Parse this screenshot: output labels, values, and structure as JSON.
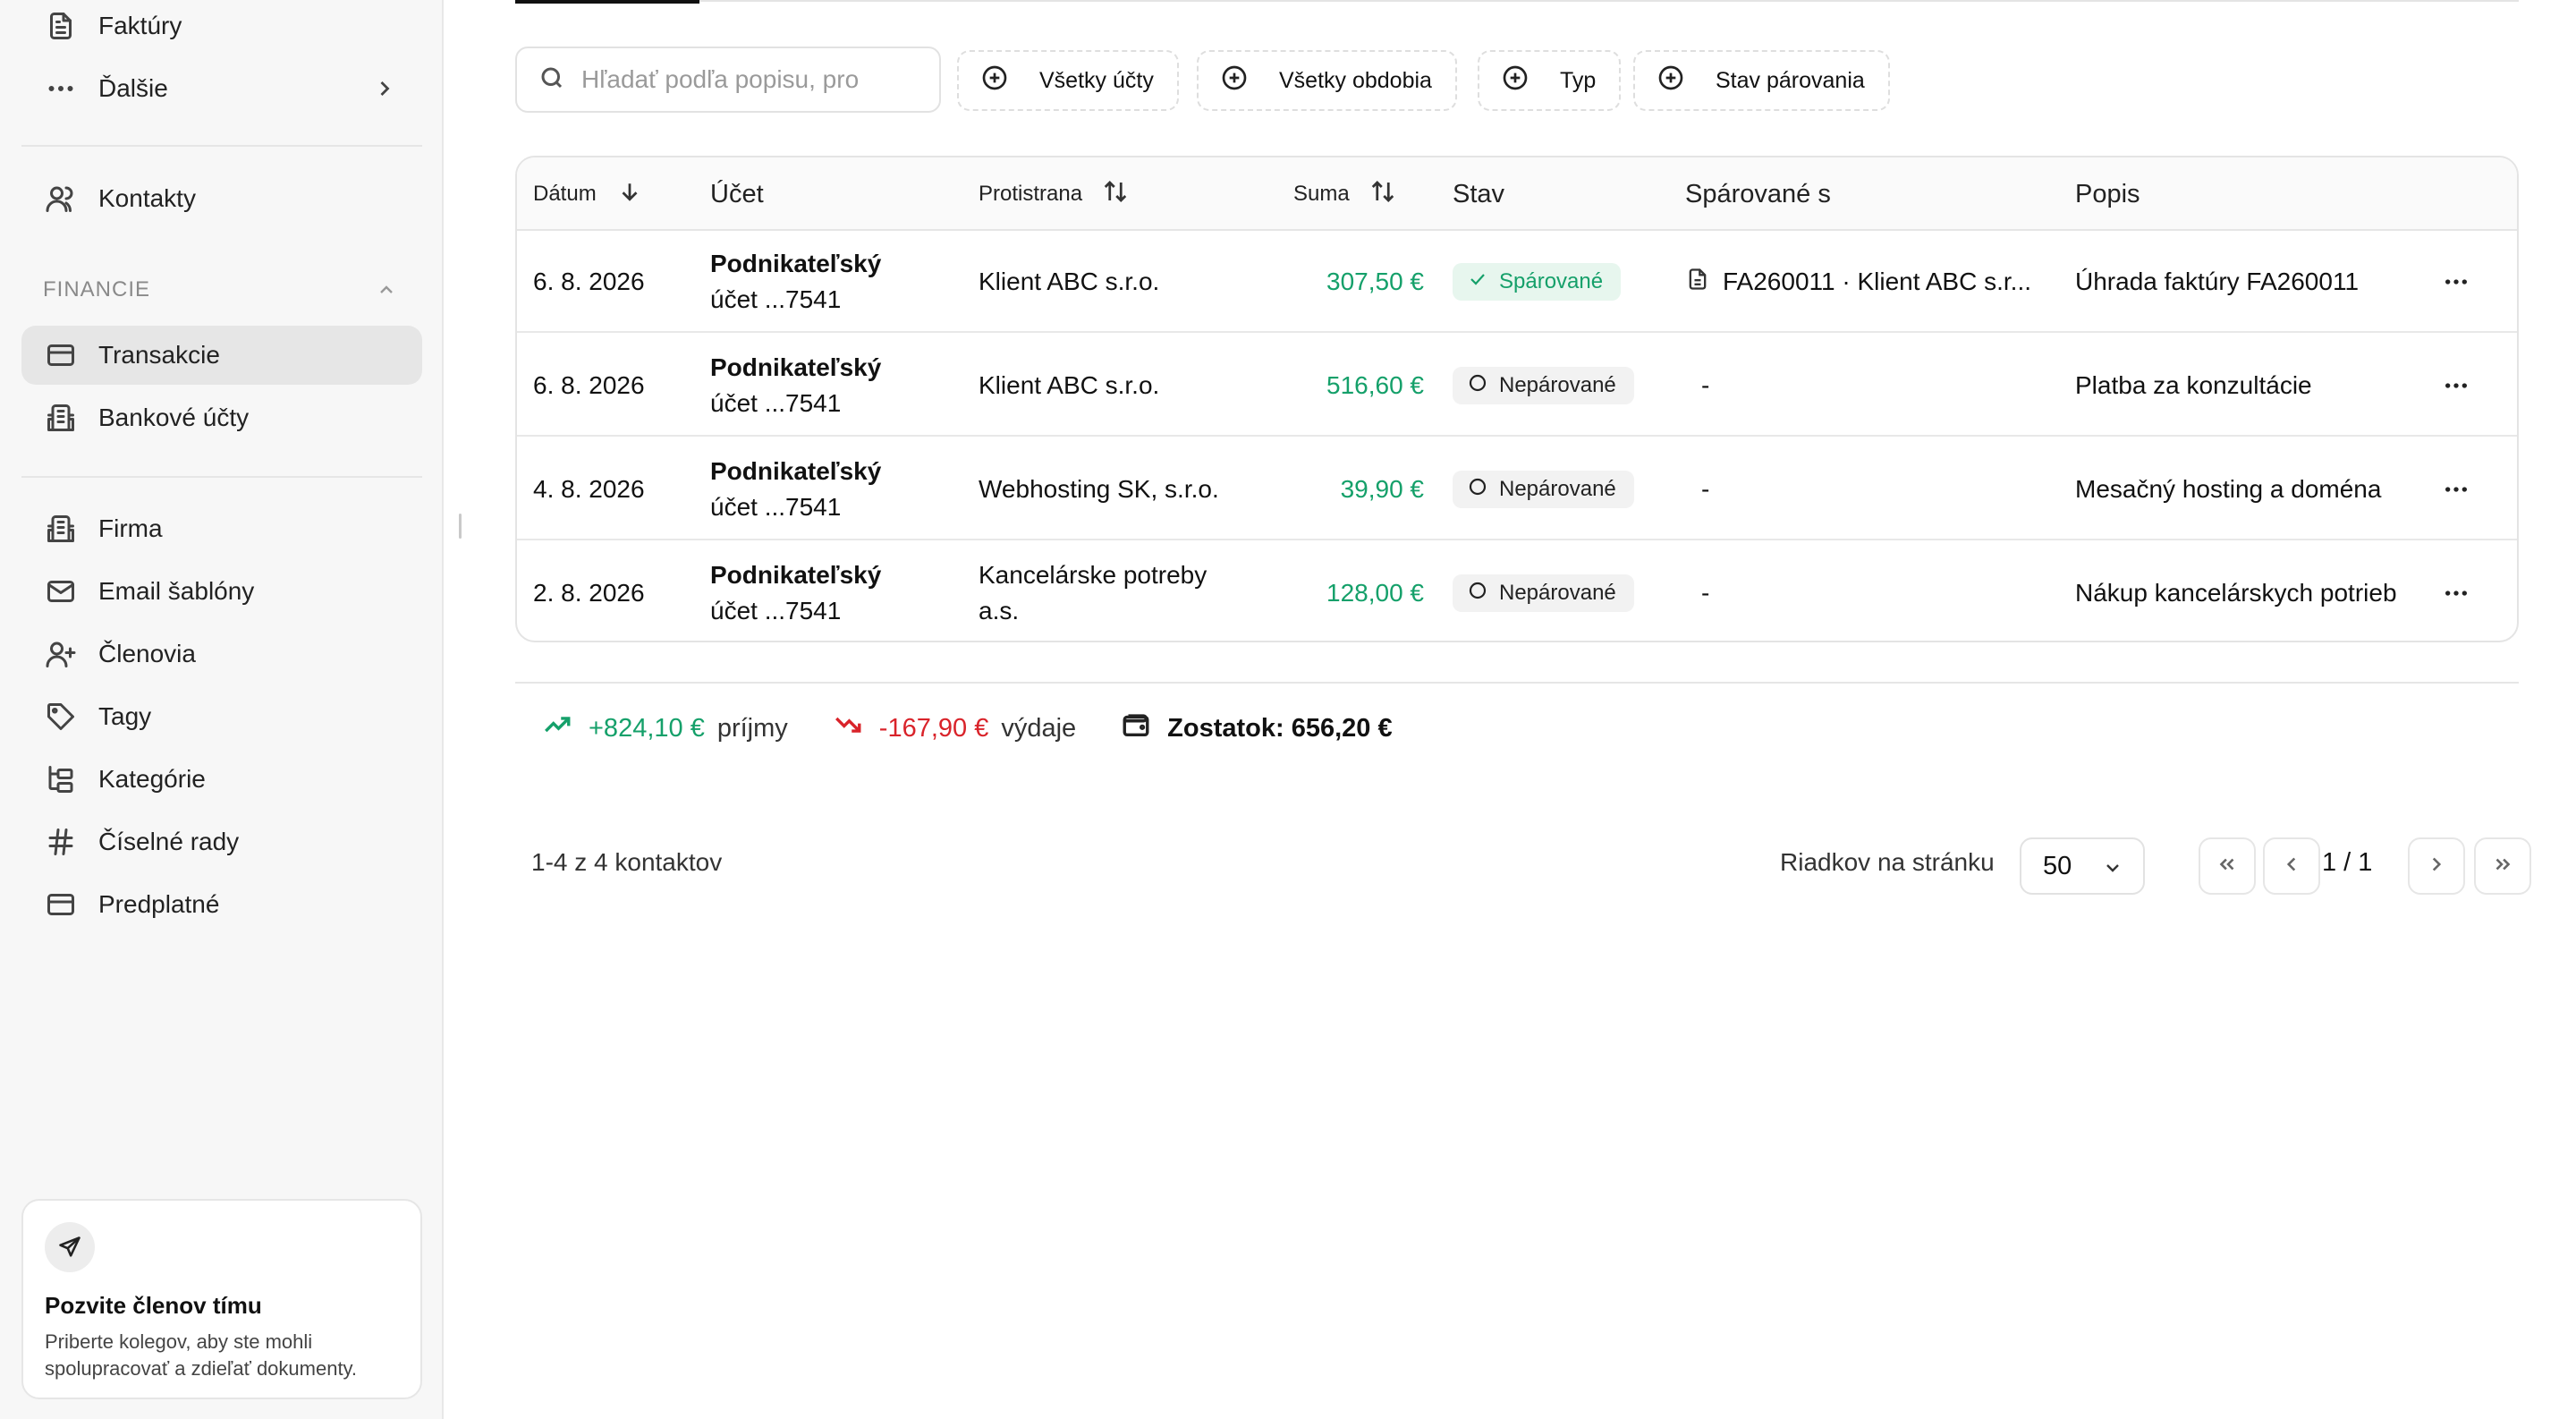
{
  "sidebar": {
    "top_items": [
      {
        "label": "Faktúry",
        "icon": "file-text-icon"
      },
      {
        "label": "Ďalšie",
        "icon": "more-horizontal-icon"
      }
    ],
    "contacts": {
      "label": "Kontakty",
      "icon": "users-icon"
    },
    "section_label": "FINANCIE",
    "finance_items": [
      {
        "label": "Transakcie",
        "icon": "credit-card-icon",
        "active": true
      },
      {
        "label": "Bankové účty",
        "icon": "bank-icon"
      }
    ],
    "settings_items": [
      {
        "label": "Firma",
        "icon": "building-icon"
      },
      {
        "label": "Email šablóny",
        "icon": "mail-icon"
      },
      {
        "label": "Členovia",
        "icon": "user-plus-icon"
      },
      {
        "label": "Tagy",
        "icon": "tag-icon"
      },
      {
        "label": "Kategórie",
        "icon": "folder-tree-icon"
      },
      {
        "label": "Číselné rady",
        "icon": "hash-icon"
      },
      {
        "label": "Predplatné",
        "icon": "credit-card-icon"
      }
    ],
    "invite": {
      "title": "Pozvite členov tímu",
      "description": "Priberte kolegov, aby ste mohli spolupracovať a zdieľať dokumenty.",
      "icon": "send-icon"
    }
  },
  "toolbar": {
    "search_placeholder": "Hľadať podľa popisu, pro",
    "filters": [
      "Všetky účty",
      "Všetky obdobia",
      "Typ",
      "Stav párovania"
    ]
  },
  "table": {
    "headers": {
      "date": "Dátum",
      "account": "Účet",
      "counterparty": "Protistrana",
      "amount": "Suma",
      "status": "Stav",
      "matched": "Spárované s",
      "description": "Popis"
    },
    "rows": [
      {
        "date": "6. 8. 2026",
        "account_name": "Podnikateľský",
        "account_num": "účet ...7541",
        "counterparty": "Klient ABC s.r.o.",
        "amount": "307,50 €",
        "status": "Spárované",
        "matched": "FA260011 · Klient ABC s.r...",
        "description": "Úhrada faktúry FA260011"
      },
      {
        "date": "6. 8. 2026",
        "account_name": "Podnikateľský",
        "account_num": "účet ...7541",
        "counterparty": "Klient ABC s.r.o.",
        "amount": "516,60 €",
        "status": "Nepárované",
        "matched": "-",
        "description": "Platba za konzultácie"
      },
      {
        "date": "4. 8. 2026",
        "account_name": "Podnikateľský",
        "account_num": "účet ...7541",
        "counterparty": "Webhosting SK, s.r.o.",
        "amount": "39,90 €",
        "status": "Nepárované",
        "matched": "-",
        "description": "Mesačný hosting a doména"
      },
      {
        "date": "2. 8. 2026",
        "account_name": "Podnikateľský",
        "account_num": "účet ...7541",
        "counterparty": "Kancelárske potreby a.s.",
        "amount": "128,00 €",
        "status": "Nepárované",
        "matched": "-",
        "description": "Nákup kancelárskych potrieb"
      }
    ]
  },
  "summary": {
    "income_value": "+824,10 €",
    "income_label": "príjmy",
    "expense_value": "-167,90 €",
    "expense_label": "výdaje",
    "balance": "Zostatok: 656,20 €"
  },
  "pagination": {
    "count_text": "1-4 z 4 kontaktov",
    "rows_label": "Riadkov na stránku",
    "rows_value": "50",
    "page_text": "1 / 1"
  },
  "colors": {
    "income": "#15a06a",
    "expense": "#d9232a",
    "active_nav": "#e6e6e6"
  }
}
